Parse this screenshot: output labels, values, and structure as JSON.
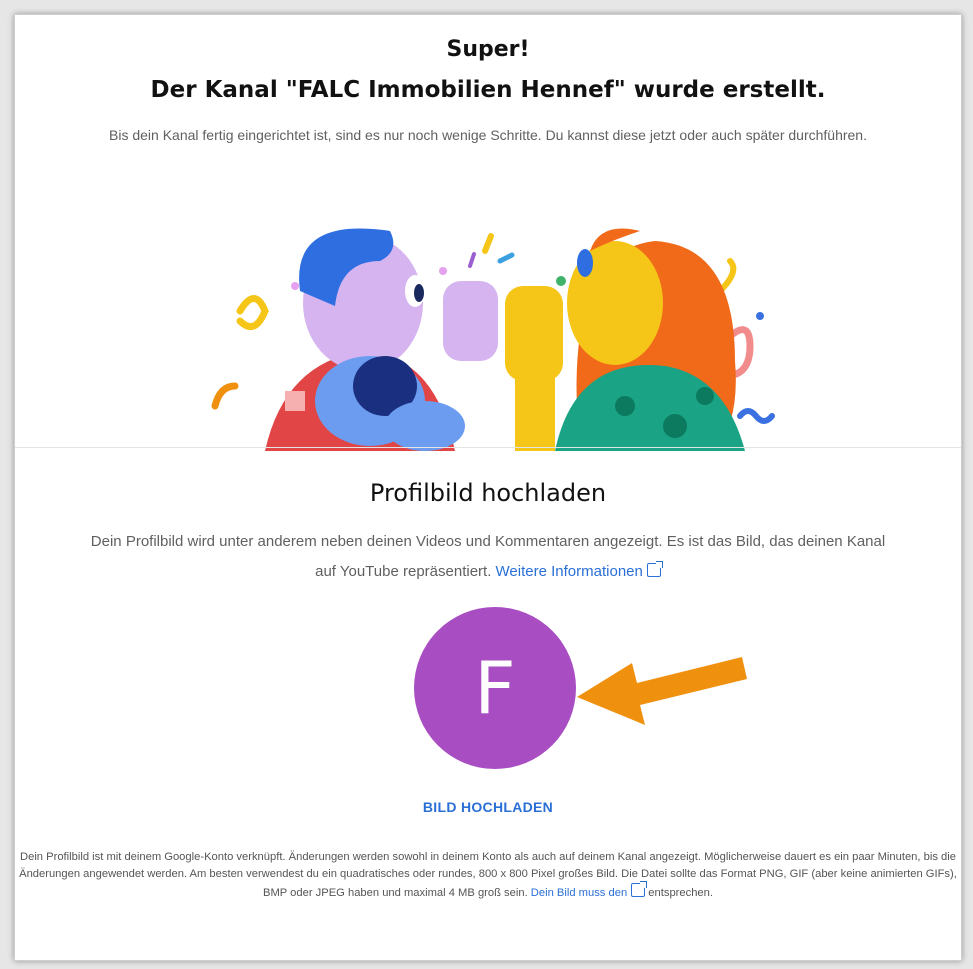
{
  "header": {
    "title_line1": "Super!",
    "title_line2": "Der Kanal \"FALC Immobilien Hennef\" wurde erstellt.",
    "intro": "Bis dein Kanal fertig eingerichtet ist, sind es nur noch wenige Schritte. Du kannst diese jetzt oder auch später durchführen."
  },
  "profile": {
    "title": "Profilbild hochladen",
    "description": "Dein Profilbild wird unter anderem neben deinen Videos und Kommentaren angezeigt. Es ist das Bild, das deinen Kanal auf YouTube repräsentiert.",
    "more_info_link": "Weitere Informationen",
    "avatar_letter": "F",
    "avatar_color": "#a94ec2",
    "upload_button": "BILD HOCHLADEN"
  },
  "footer": {
    "text": "Dein Profilbild ist mit deinem Google-Konto verknüpft. Änderungen werden sowohl in deinem Konto als auch auf deinem Kanal angezeigt. Möglicherweise dauert es ein paar Minuten, bis die Änderungen angewendet werden. Am besten verwendest du ein quadratisches oder rundes, 800 x 800 Pixel großes Bild. Die Datei sollte das Format PNG, GIF (aber keine animierten GIFs), BMP oder JPEG haben und maximal 4 MB groß sein.",
    "link_text": "Dein Bild muss den",
    "after_link": "entsprechen."
  },
  "colors": {
    "accent_link": "#2a6fd6",
    "arrow": "#f0900f"
  }
}
